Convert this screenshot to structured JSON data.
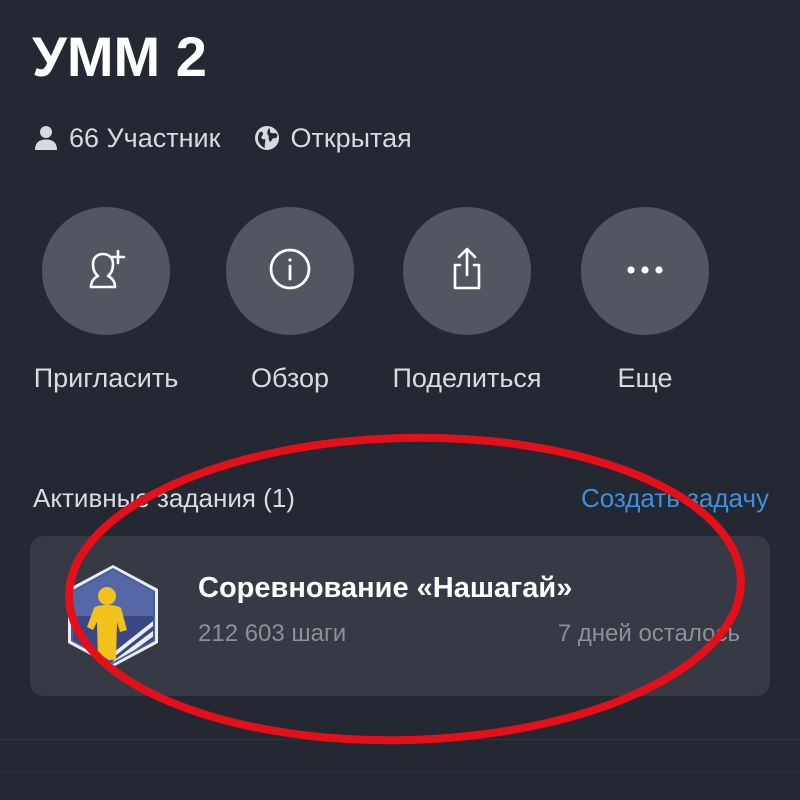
{
  "header": {
    "title": "УММ 2",
    "members": "66 Участник",
    "visibility": "Открытая"
  },
  "actions": [
    {
      "label": "Пригласить",
      "icon": "add-user-icon"
    },
    {
      "label": "Обзор",
      "icon": "info-icon"
    },
    {
      "label": "Поделиться",
      "icon": "share-icon"
    },
    {
      "label": "Еще",
      "icon": "more-icon"
    }
  ],
  "tasks": {
    "heading": "Активные задания (1)",
    "create_label": "Создать задачу",
    "items": [
      {
        "title": "Соревнование «Нашагай»",
        "steps": "212 603 шаги",
        "days_left": "7 дней осталось",
        "icon": "challenge-badge-icon"
      }
    ]
  },
  "colors": {
    "background": "#232833",
    "card": "#363a44",
    "action_circle": "#535660",
    "link": "#3f8fdb",
    "annotation": "#e3101a"
  }
}
